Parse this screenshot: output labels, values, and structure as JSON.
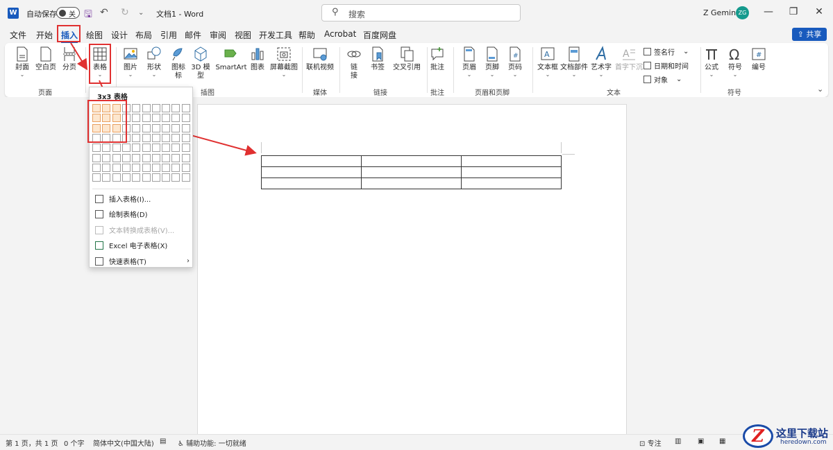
{
  "titlebar": {
    "autosave_label": "自动保存",
    "autosave_state": "关",
    "doc_title": "文档1 - Word",
    "search_placeholder": "搜索",
    "user_name": "Z Gemini",
    "user_initials": "ZG",
    "logo": "W"
  },
  "tabs": [
    "文件",
    "开始",
    "插入",
    "绘图",
    "设计",
    "布局",
    "引用",
    "邮件",
    "审阅",
    "视图",
    "开发工具",
    "帮助",
    "Acrobat",
    "百度网盘"
  ],
  "active_tab": "插入",
  "share_label": "共享",
  "ribbon": {
    "pages": {
      "cover": "封面",
      "blank": "空白页",
      "break": "分页",
      "group": "页面"
    },
    "tables": {
      "table": "表格"
    },
    "illustrations": {
      "pictures": "图片",
      "shapes": "形状",
      "icons": "图标",
      "icons2": "标",
      "models": "3D 模",
      "models2": "型",
      "smartart": "SmartArt",
      "chart": "图表",
      "screenshot": "屏幕截图",
      "group": "插图"
    },
    "media": {
      "video": "联机视频",
      "group": "媒体"
    },
    "links": {
      "link": "链",
      "link2": "接",
      "bookmark": "书签",
      "crossref": "交叉引用",
      "group": "链接"
    },
    "comments": {
      "comment": "批注",
      "group": "批注"
    },
    "header_footer": {
      "header": "页眉",
      "footer": "页脚",
      "page_number": "页码",
      "group": "页眉和页脚"
    },
    "text": {
      "textbox": "文本框",
      "quickparts": "文档部件",
      "wordart": "艺术字",
      "dropcap": "首字下沉",
      "signature": "签名行",
      "datetime": "日期和时间",
      "object": "对象",
      "group": "文本"
    },
    "symbols": {
      "equation": "公式",
      "symbol": "符号",
      "number": "编号",
      "group": "符号"
    }
  },
  "dropdown": {
    "title": "3x3 表格",
    "grid_cols": 10,
    "grid_rows": 8,
    "selected_cols": 3,
    "selected_rows": 3,
    "items": [
      {
        "label": "插入表格(I)...",
        "disabled": false
      },
      {
        "label": "绘制表格(D)",
        "disabled": false
      },
      {
        "label": "文本转换成表格(V)...",
        "disabled": true
      },
      {
        "label": "Excel 电子表格(X)",
        "disabled": false
      },
      {
        "label": "快速表格(T)",
        "disabled": false,
        "submenu": true
      }
    ]
  },
  "document": {
    "table_rows": 3,
    "table_cols": 3
  },
  "statusbar": {
    "page": "第 1 页，共 1 页",
    "words": "0 个字",
    "language": "简体中文(中国大陆)",
    "accessibility": "辅助功能: 一切就绪",
    "focus": "专注"
  },
  "watermark": {
    "logo": "Z",
    "text": "这里下载站",
    "sub": "heredown.com"
  },
  "colors": {
    "accent": "#185abd",
    "annotation": "#e03030",
    "grid_selected": "#fde7cf"
  }
}
